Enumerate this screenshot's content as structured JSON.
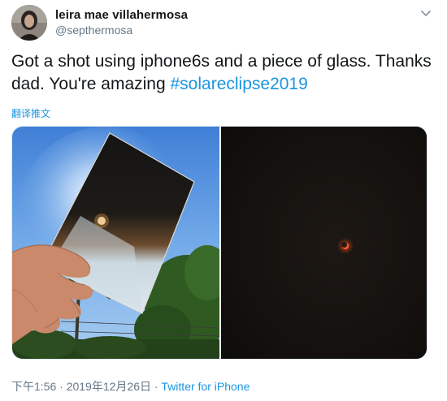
{
  "user": {
    "name": "leira mae villahermosa",
    "handle": "@septhermosa"
  },
  "tweet": {
    "text_main": "Got a shot using iphone6s and a piece of glass. Thanks dad. You're amazing ",
    "hashtag": "#solareclipse2019",
    "translate_label": "翻译推文"
  },
  "meta": {
    "time": "下午1:56 · 2019年12月26日 · ",
    "source": "Twitter for iPhone"
  },
  "icons": {
    "menu": "chevron-down-icon"
  },
  "colors": {
    "link": "#1b95e0",
    "muted": "#657786",
    "text": "#14171a"
  }
}
